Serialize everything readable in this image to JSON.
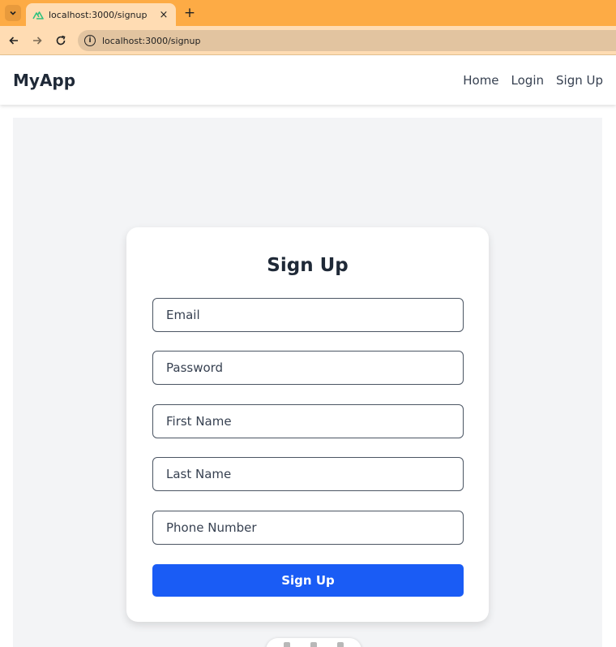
{
  "browser": {
    "tab_title": "localhost:3000/signup",
    "tab_close": "×",
    "new_tab": "+",
    "url": "localhost:3000/signup"
  },
  "app": {
    "brand": "MyApp",
    "nav": [
      "Home",
      "Login",
      "Sign Up"
    ]
  },
  "form": {
    "title": "Sign Up",
    "fields": [
      {
        "placeholder": "Email",
        "value": ""
      },
      {
        "placeholder": "Password",
        "value": ""
      },
      {
        "placeholder": "First Name",
        "value": ""
      },
      {
        "placeholder": "Last Name",
        "value": ""
      },
      {
        "placeholder": "Phone Number",
        "value": ""
      }
    ],
    "submit_label": "Sign Up"
  },
  "colors": {
    "tabstrip": "#fdab45",
    "toolbar": "#ffdcb3",
    "primary_button": "#1a5cf5",
    "content_bg": "#f3f4f6",
    "brand_favicon": "#2ec27e"
  },
  "icons": {
    "tab_menu": "chevron-down-icon",
    "favicon": "nuxt-logo-icon",
    "back": "arrow-left-icon",
    "forward": "arrow-right-icon",
    "reload": "reload-icon",
    "site_info": "info-icon"
  }
}
